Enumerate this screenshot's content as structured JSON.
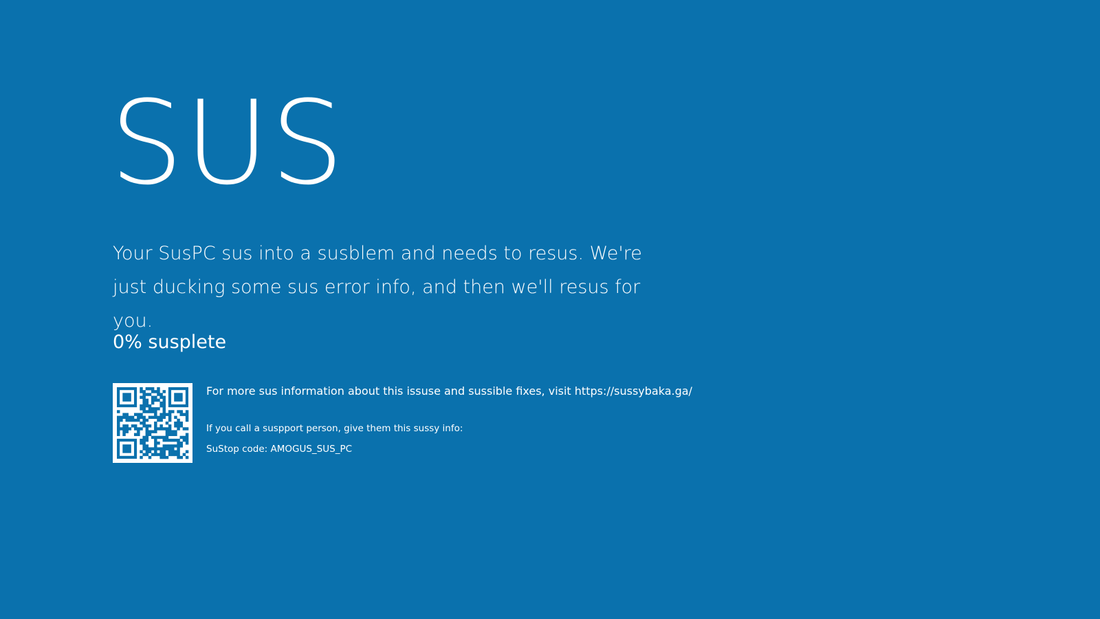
{
  "screen": {
    "background_color": "#0a71ad",
    "text_color": "#ffffff",
    "face_text": "SUS",
    "message": "Your SusPC sus into a susblem and needs to resus. We're just ducking some sus error info, and then we'll resus for you.",
    "progress_percent": 0,
    "progress_text": "0% susplete",
    "qr_icon": "qr-code-icon",
    "more_info": "For more sus information about this issuse and sussible fixes, visit https://sussybaka.ga/",
    "support_prompt": "If you call a suspport person, give them this sussy info:",
    "stop_code_label": "SuStop code: AMOGUS_SUS_PC"
  }
}
